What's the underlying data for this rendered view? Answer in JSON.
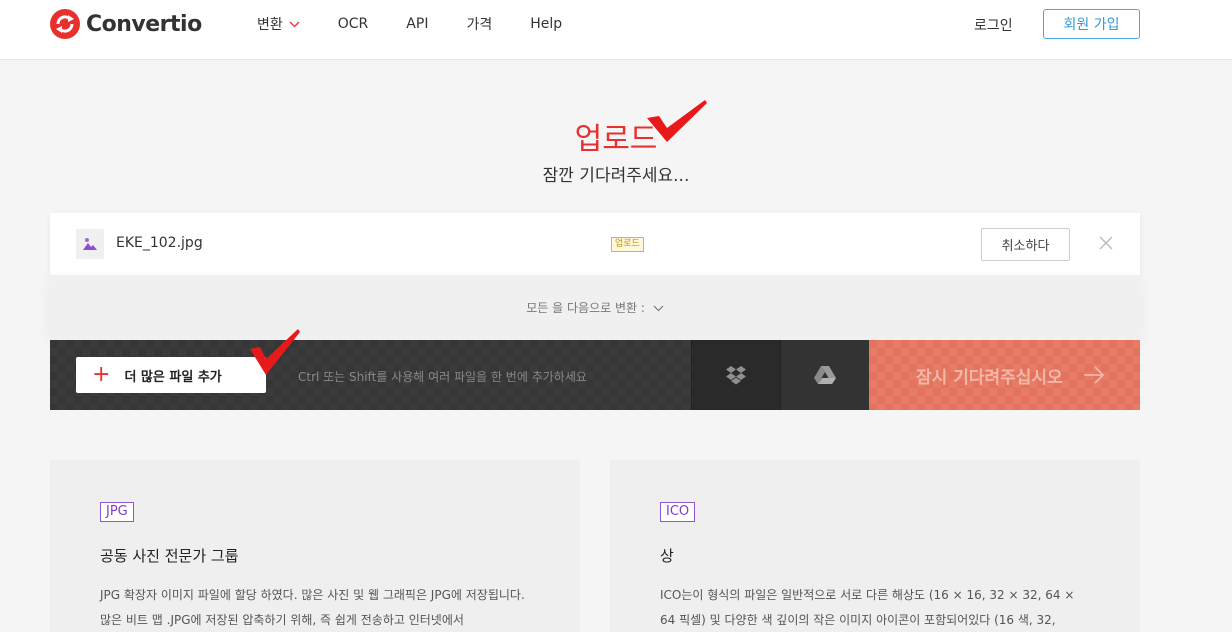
{
  "header": {
    "logo_text": "Convertio",
    "nav": [
      {
        "label": "변환",
        "has_dropdown": true
      },
      {
        "label": "OCR"
      },
      {
        "label": "API"
      },
      {
        "label": "가격"
      },
      {
        "label": "Help"
      }
    ],
    "login_label": "로그인",
    "signup_label": "회원 가입"
  },
  "status": {
    "title": "업로드",
    "subtitle": "잠깐 기다려주세요..."
  },
  "file": {
    "name": "EKE_102.jpg",
    "badge": "업로드",
    "cancel_label": "취소하다"
  },
  "convert_all": {
    "label": "모든 을 다음으로 변환 :"
  },
  "actions": {
    "add_more_label": "더 많은 파일 추가",
    "hint": "Ctrl 또는 Shift를 사용해 여러 파일을 한 번에 추가하세요",
    "wait_label": "잠시 기다려주십시오"
  },
  "cards": [
    {
      "badge": "JPG",
      "title": "공동 사진 전문가 그룹",
      "body": "JPG 확장자 이미지 파일에 할당 하였다. 많은 사진 및 웹 그래픽은 JPG에 저장됩니다. 많은 비트 맵 .JPG에 저장된 압축하기 위해, 즉 쉽게 전송하고 인터넷에서"
    },
    {
      "badge": "ICO",
      "title": "상",
      "body": "ICO는이 형식의 파일은 일반적으로 서로 다른 해상도 (16 × 16, 32 × 32, 64 × 64 픽셀) 및 다양한 색 깊이의 작은 이미지 아이콘이 포함되어있다 (16 색, 32,"
    }
  ],
  "colors": {
    "brand_red": "#e8312f",
    "signup_blue": "#2f9bd8",
    "badge_purple": "#7b3fcc",
    "wait_button": "#e3735d"
  }
}
